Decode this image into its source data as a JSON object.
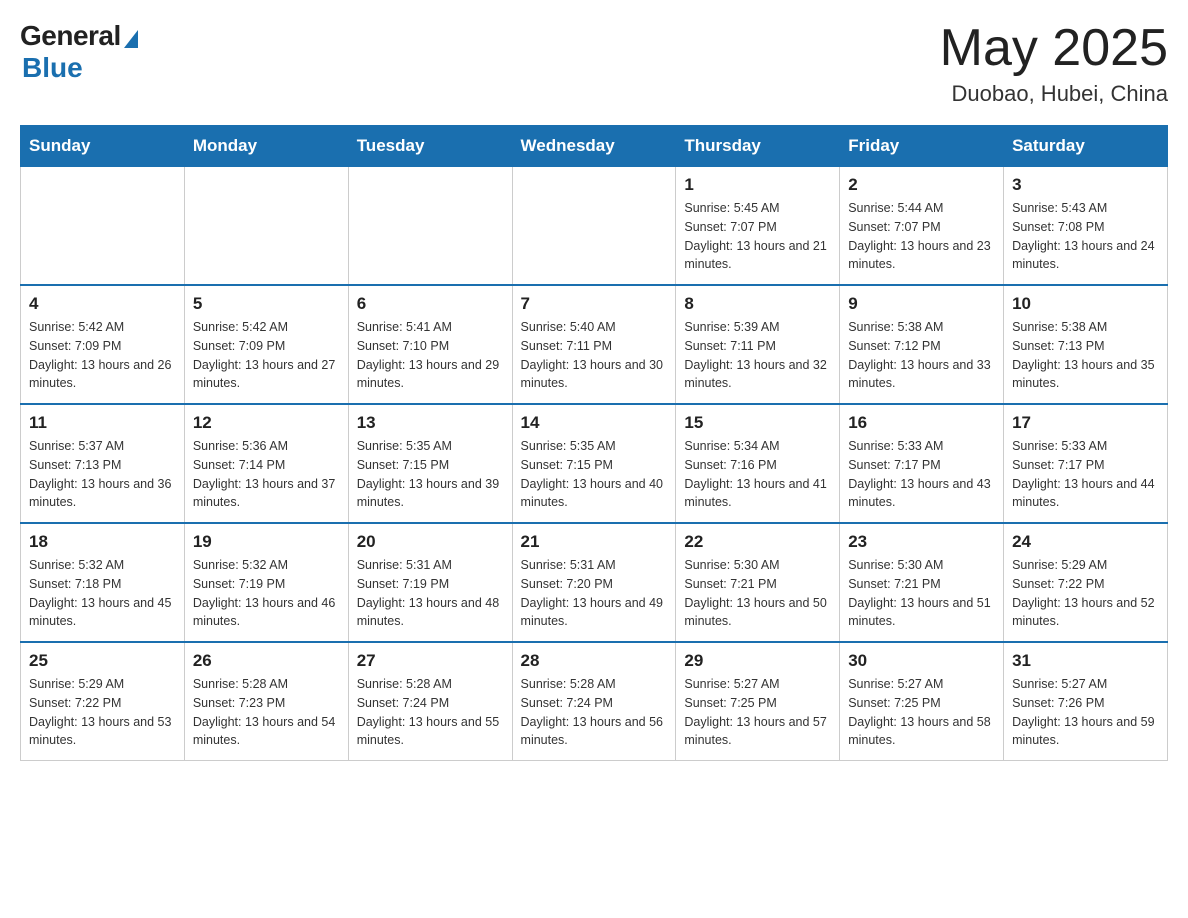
{
  "logo": {
    "general": "General",
    "blue": "Blue"
  },
  "header": {
    "month_year": "May 2025",
    "location": "Duobao, Hubei, China"
  },
  "days_of_week": [
    "Sunday",
    "Monday",
    "Tuesday",
    "Wednesday",
    "Thursday",
    "Friday",
    "Saturday"
  ],
  "weeks": [
    [
      {
        "day": "",
        "info": ""
      },
      {
        "day": "",
        "info": ""
      },
      {
        "day": "",
        "info": ""
      },
      {
        "day": "",
        "info": ""
      },
      {
        "day": "1",
        "info": "Sunrise: 5:45 AM\nSunset: 7:07 PM\nDaylight: 13 hours and 21 minutes."
      },
      {
        "day": "2",
        "info": "Sunrise: 5:44 AM\nSunset: 7:07 PM\nDaylight: 13 hours and 23 minutes."
      },
      {
        "day": "3",
        "info": "Sunrise: 5:43 AM\nSunset: 7:08 PM\nDaylight: 13 hours and 24 minutes."
      }
    ],
    [
      {
        "day": "4",
        "info": "Sunrise: 5:42 AM\nSunset: 7:09 PM\nDaylight: 13 hours and 26 minutes."
      },
      {
        "day": "5",
        "info": "Sunrise: 5:42 AM\nSunset: 7:09 PM\nDaylight: 13 hours and 27 minutes."
      },
      {
        "day": "6",
        "info": "Sunrise: 5:41 AM\nSunset: 7:10 PM\nDaylight: 13 hours and 29 minutes."
      },
      {
        "day": "7",
        "info": "Sunrise: 5:40 AM\nSunset: 7:11 PM\nDaylight: 13 hours and 30 minutes."
      },
      {
        "day": "8",
        "info": "Sunrise: 5:39 AM\nSunset: 7:11 PM\nDaylight: 13 hours and 32 minutes."
      },
      {
        "day": "9",
        "info": "Sunrise: 5:38 AM\nSunset: 7:12 PM\nDaylight: 13 hours and 33 minutes."
      },
      {
        "day": "10",
        "info": "Sunrise: 5:38 AM\nSunset: 7:13 PM\nDaylight: 13 hours and 35 minutes."
      }
    ],
    [
      {
        "day": "11",
        "info": "Sunrise: 5:37 AM\nSunset: 7:13 PM\nDaylight: 13 hours and 36 minutes."
      },
      {
        "day": "12",
        "info": "Sunrise: 5:36 AM\nSunset: 7:14 PM\nDaylight: 13 hours and 37 minutes."
      },
      {
        "day": "13",
        "info": "Sunrise: 5:35 AM\nSunset: 7:15 PM\nDaylight: 13 hours and 39 minutes."
      },
      {
        "day": "14",
        "info": "Sunrise: 5:35 AM\nSunset: 7:15 PM\nDaylight: 13 hours and 40 minutes."
      },
      {
        "day": "15",
        "info": "Sunrise: 5:34 AM\nSunset: 7:16 PM\nDaylight: 13 hours and 41 minutes."
      },
      {
        "day": "16",
        "info": "Sunrise: 5:33 AM\nSunset: 7:17 PM\nDaylight: 13 hours and 43 minutes."
      },
      {
        "day": "17",
        "info": "Sunrise: 5:33 AM\nSunset: 7:17 PM\nDaylight: 13 hours and 44 minutes."
      }
    ],
    [
      {
        "day": "18",
        "info": "Sunrise: 5:32 AM\nSunset: 7:18 PM\nDaylight: 13 hours and 45 minutes."
      },
      {
        "day": "19",
        "info": "Sunrise: 5:32 AM\nSunset: 7:19 PM\nDaylight: 13 hours and 46 minutes."
      },
      {
        "day": "20",
        "info": "Sunrise: 5:31 AM\nSunset: 7:19 PM\nDaylight: 13 hours and 48 minutes."
      },
      {
        "day": "21",
        "info": "Sunrise: 5:31 AM\nSunset: 7:20 PM\nDaylight: 13 hours and 49 minutes."
      },
      {
        "day": "22",
        "info": "Sunrise: 5:30 AM\nSunset: 7:21 PM\nDaylight: 13 hours and 50 minutes."
      },
      {
        "day": "23",
        "info": "Sunrise: 5:30 AM\nSunset: 7:21 PM\nDaylight: 13 hours and 51 minutes."
      },
      {
        "day": "24",
        "info": "Sunrise: 5:29 AM\nSunset: 7:22 PM\nDaylight: 13 hours and 52 minutes."
      }
    ],
    [
      {
        "day": "25",
        "info": "Sunrise: 5:29 AM\nSunset: 7:22 PM\nDaylight: 13 hours and 53 minutes."
      },
      {
        "day": "26",
        "info": "Sunrise: 5:28 AM\nSunset: 7:23 PM\nDaylight: 13 hours and 54 minutes."
      },
      {
        "day": "27",
        "info": "Sunrise: 5:28 AM\nSunset: 7:24 PM\nDaylight: 13 hours and 55 minutes."
      },
      {
        "day": "28",
        "info": "Sunrise: 5:28 AM\nSunset: 7:24 PM\nDaylight: 13 hours and 56 minutes."
      },
      {
        "day": "29",
        "info": "Sunrise: 5:27 AM\nSunset: 7:25 PM\nDaylight: 13 hours and 57 minutes."
      },
      {
        "day": "30",
        "info": "Sunrise: 5:27 AM\nSunset: 7:25 PM\nDaylight: 13 hours and 58 minutes."
      },
      {
        "day": "31",
        "info": "Sunrise: 5:27 AM\nSunset: 7:26 PM\nDaylight: 13 hours and 59 minutes."
      }
    ]
  ]
}
